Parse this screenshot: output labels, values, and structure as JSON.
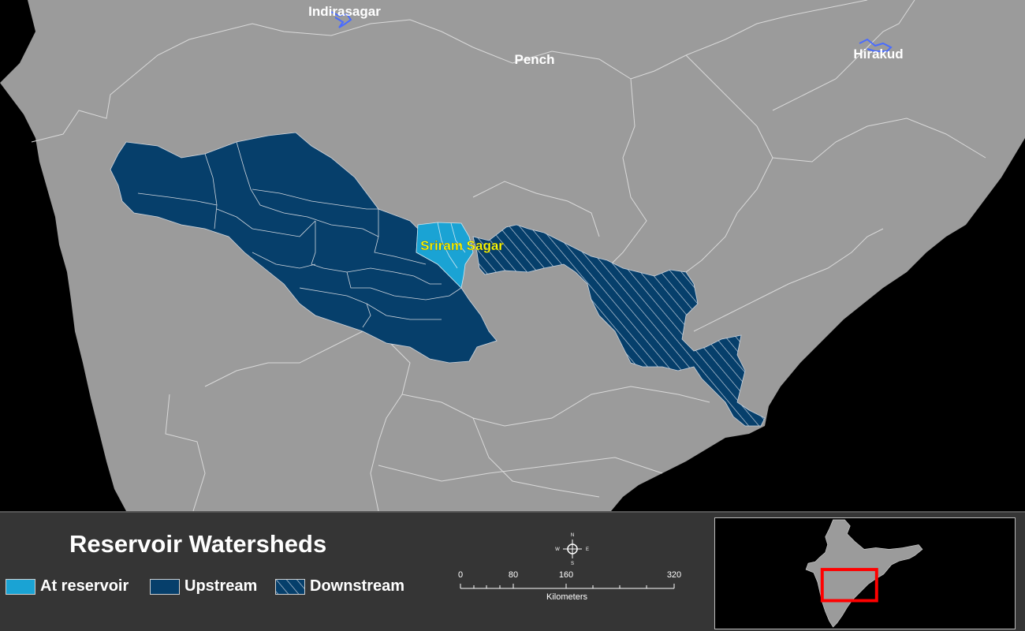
{
  "map": {
    "reservoir_labels": {
      "indirasagar": "Indirasagar",
      "pench": "Pench",
      "hirakud": "Hirakud",
      "sriram_sagar": "Sriram Sagar"
    }
  },
  "legend": {
    "title": "Reservoir Watersheds",
    "items": [
      {
        "label": "At reservoir",
        "color": "#1aa3d4"
      },
      {
        "label": "Upstream",
        "color": "#063f6b"
      },
      {
        "label": "Downstream",
        "color": "#063f6b"
      }
    ]
  },
  "scale_bar": {
    "ticks": [
      "0",
      "80",
      "160",
      "320"
    ],
    "unit": "Kilometers",
    "compass": {
      "n": "N",
      "e": "E",
      "s": "S",
      "w": "W"
    }
  },
  "colors": {
    "land": "#9b9b9b",
    "sea": "#000000",
    "boundary": "#d9d9d9",
    "upstream": "#063f6b",
    "at_reservoir": "#1aa3d4",
    "highlight_label": "#ffff00",
    "inset_frame": "#ff0000",
    "water": "#4a6cff"
  }
}
